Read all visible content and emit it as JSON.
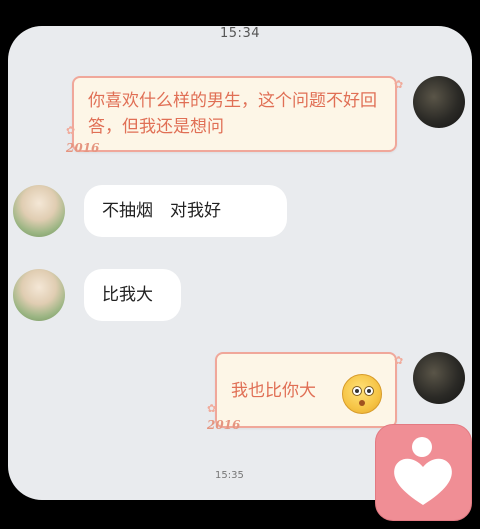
{
  "status": {
    "time": "15:34",
    "bottom_time": "15:35"
  },
  "messages": [
    {
      "side": "right",
      "text": "你喜欢什么样的男生，这个问题不好回答，但我还是想问",
      "year": "2016",
      "style": "decorated"
    },
    {
      "side": "left",
      "text": "不抽烟　对我好",
      "style": "plain"
    },
    {
      "side": "left",
      "text": "比我大",
      "style": "plain"
    },
    {
      "side": "right",
      "text": "我也比你大",
      "year": "2016",
      "style": "decorated",
      "emoji": "surprised-face-emoji"
    }
  ],
  "app_icon": {
    "name": "heart-app-icon",
    "color": "#f08e95"
  },
  "colors": {
    "background": "#e9ebee",
    "bubble_text": "#e06f55",
    "bubble_border": "#f0a79a"
  }
}
